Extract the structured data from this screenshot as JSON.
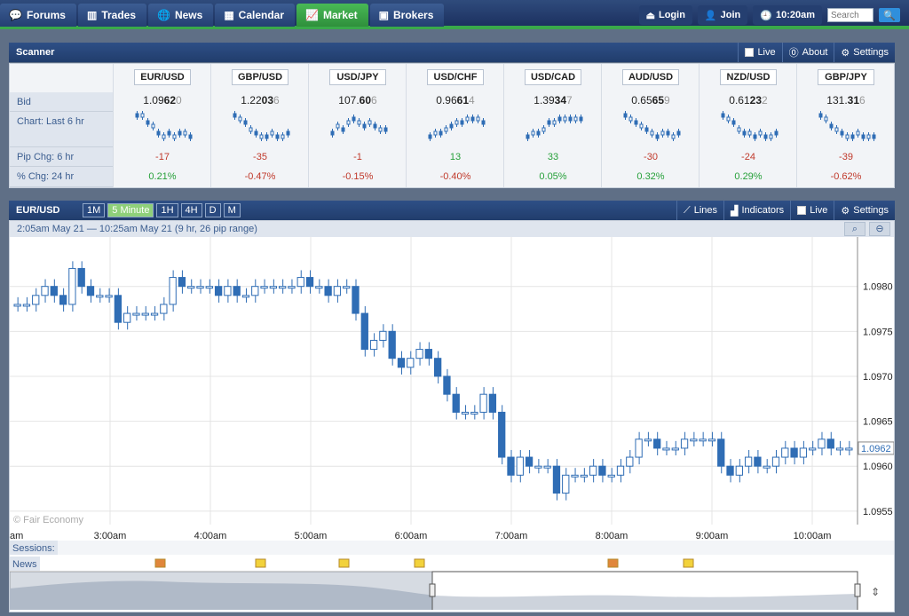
{
  "nav": {
    "tabs": [
      {
        "label": "Forums",
        "icon": "forums-icon"
      },
      {
        "label": "Trades",
        "icon": "trades-icon"
      },
      {
        "label": "News",
        "icon": "news-icon"
      },
      {
        "label": "Calendar",
        "icon": "calendar-icon"
      },
      {
        "label": "Market",
        "icon": "market-icon",
        "active": true
      },
      {
        "label": "Brokers",
        "icon": "brokers-icon"
      }
    ],
    "login": "Login",
    "join": "Join",
    "time": "10:20am",
    "search_placeholder": "Search"
  },
  "scanner": {
    "title": "Scanner",
    "tools": {
      "live": "Live",
      "about": "About",
      "settings": "Settings"
    },
    "row_labels": {
      "bid": "Bid",
      "chart": "Chart: Last 6 hr",
      "pip": "Pip Chg: 6 hr",
      "pct": "% Chg: 24 hr"
    },
    "pairs": [
      {
        "name": "EUR/USD",
        "bid_a": "1.09",
        "bid_b": "62",
        "bid_c": "0",
        "pip": "-17",
        "pct": "0.21%",
        "pip_dir": "neg",
        "pct_dir": "pos"
      },
      {
        "name": "GBP/USD",
        "bid_a": "1.22",
        "bid_b": "03",
        "bid_c": "6",
        "pip": "-35",
        "pct": "-0.47%",
        "pip_dir": "neg",
        "pct_dir": "neg"
      },
      {
        "name": "USD/JPY",
        "bid_a": "107.",
        "bid_b": "60",
        "bid_c": "6",
        "pip": "-1",
        "pct": "-0.15%",
        "pip_dir": "neg",
        "pct_dir": "neg"
      },
      {
        "name": "USD/CHF",
        "bid_a": "0.96",
        "bid_b": "61",
        "bid_c": "4",
        "pip": "13",
        "pct": "-0.40%",
        "pip_dir": "pos",
        "pct_dir": "neg"
      },
      {
        "name": "USD/CAD",
        "bid_a": "1.39",
        "bid_b": "34",
        "bid_c": "7",
        "pip": "33",
        "pct": "0.05%",
        "pip_dir": "pos",
        "pct_dir": "pos"
      },
      {
        "name": "AUD/USD",
        "bid_a": "0.65",
        "bid_b": "65",
        "bid_c": "9",
        "pip": "-30",
        "pct": "0.32%",
        "pip_dir": "neg",
        "pct_dir": "pos"
      },
      {
        "name": "NZD/USD",
        "bid_a": "0.61",
        "bid_b": "23",
        "bid_c": "2",
        "pip": "-24",
        "pct": "0.29%",
        "pip_dir": "neg",
        "pct_dir": "pos"
      },
      {
        "name": "GBP/JPY",
        "bid_a": "131.",
        "bid_b": "31",
        "bid_c": "6",
        "pip": "-39",
        "pct": "-0.62%",
        "pip_dir": "neg",
        "pct_dir": "neg"
      }
    ]
  },
  "chart_panel": {
    "pair": "EUR/USD",
    "timeframes": [
      "1M",
      "5 Minute",
      "1H",
      "4H",
      "D",
      "M"
    ],
    "active_timeframe": "5 Minute",
    "tools": {
      "lines": "Lines",
      "indicators": "Indicators",
      "live": "Live",
      "settings": "Settings"
    },
    "range_text": "2:05am May 21 — 10:25am May 21 (9 hr, 26 pip range)",
    "watermark": "© Fair Economy",
    "sessions_label": "Sessions:",
    "news_label": "News",
    "current_price": "1.0962"
  },
  "chart_data": {
    "type": "candlestick",
    "title": "EUR/USD",
    "x_ticks": [
      "am",
      "3:00am",
      "4:00am",
      "5:00am",
      "6:00am",
      "7:00am",
      "8:00am",
      "9:00am",
      "10:00am"
    ],
    "y_ticks": [
      "1.0980",
      "1.0975",
      "1.0970",
      "1.0965",
      "1.0960",
      "1.0955"
    ],
    "ylim": [
      1.09535,
      1.09855
    ],
    "grid": true,
    "closes": [
      1.0978,
      1.0978,
      1.0979,
      1.098,
      1.0979,
      1.0978,
      1.0982,
      1.098,
      1.0979,
      1.0979,
      1.0979,
      1.0976,
      1.0977,
      1.0977,
      1.0977,
      1.0977,
      1.0978,
      1.0981,
      1.098,
      1.098,
      1.098,
      1.098,
      1.0979,
      1.098,
      1.0979,
      1.0979,
      1.098,
      1.098,
      1.098,
      1.098,
      1.098,
      1.0981,
      1.098,
      1.098,
      1.0979,
      1.098,
      1.098,
      1.0977,
      1.0973,
      1.0974,
      1.0975,
      1.0972,
      1.0971,
      1.0972,
      1.0973,
      1.0972,
      1.097,
      1.0968,
      1.0966,
      1.0966,
      1.0966,
      1.0968,
      1.0966,
      1.0961,
      1.0959,
      1.0961,
      1.096,
      1.096,
      1.096,
      1.0957,
      1.0959,
      1.0959,
      1.0959,
      1.096,
      1.0959,
      1.0959,
      1.096,
      1.0961,
      1.0963,
      1.0963,
      1.0962,
      1.0962,
      1.0962,
      1.0963,
      1.0963,
      1.0963,
      1.0963,
      1.096,
      1.0959,
      1.096,
      1.0961,
      1.096,
      1.096,
      1.0961,
      1.0962,
      1.0961,
      1.0962,
      1.0962,
      1.0963,
      1.0962,
      1.0962,
      1.0962
    ],
    "current": 1.0962
  }
}
